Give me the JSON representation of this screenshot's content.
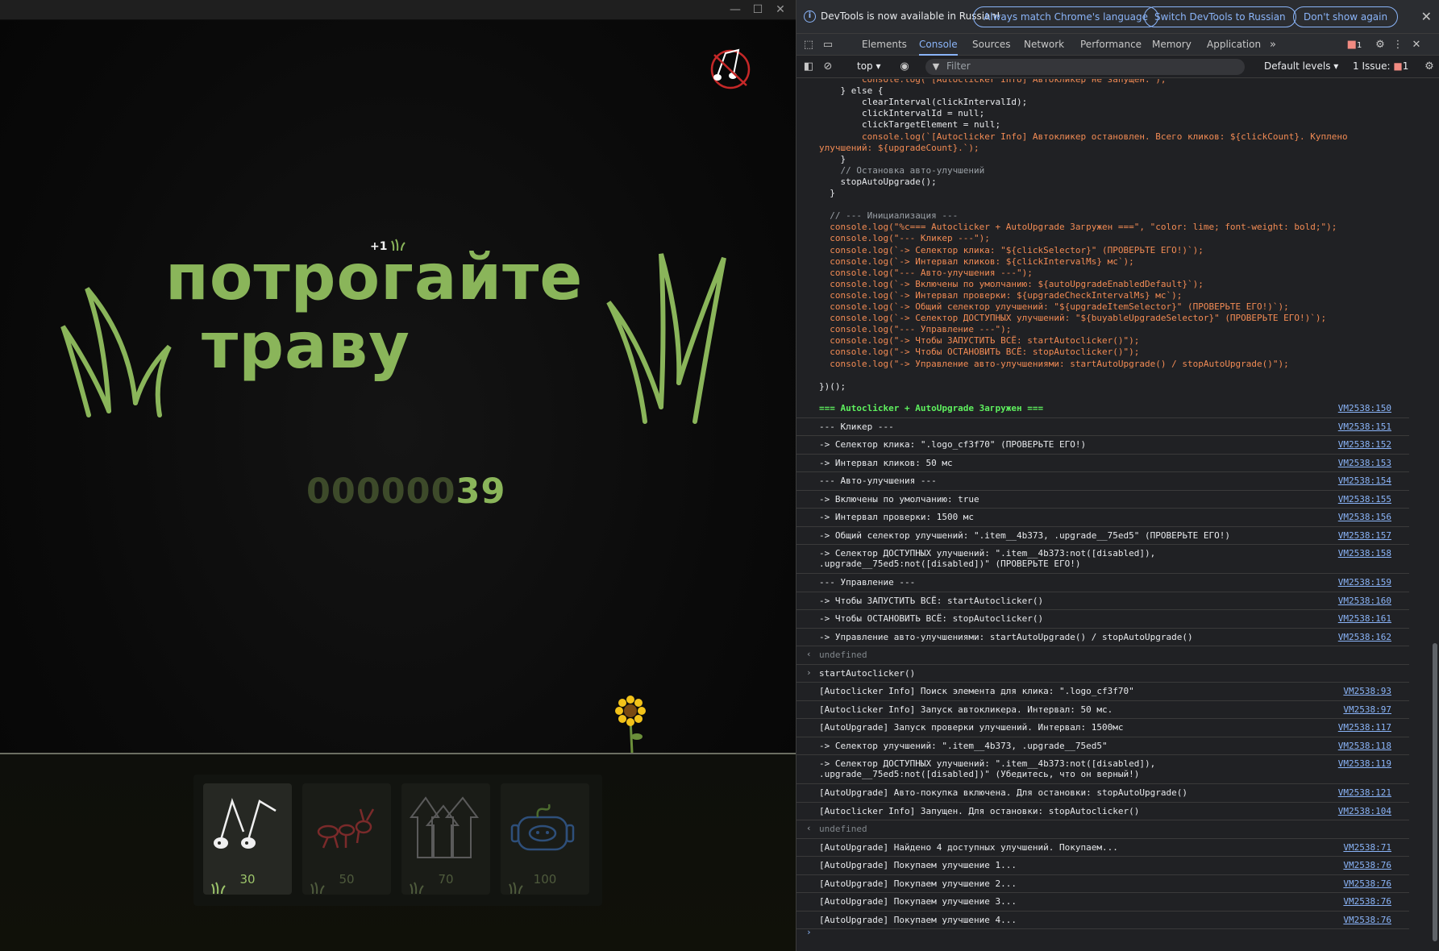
{
  "game": {
    "title_line1": "потрогайте",
    "title_line2": "траву",
    "plus_one": "+1",
    "counter_zeros": "000000",
    "counter_value": "39",
    "shop": [
      {
        "name": "music-upgrade",
        "price": "30",
        "available": true
      },
      {
        "name": "ant-upgrade",
        "price": "50",
        "available": false
      },
      {
        "name": "arrows-upgrade",
        "price": "70",
        "available": false
      },
      {
        "name": "robot-upgrade",
        "price": "100",
        "available": false
      }
    ]
  },
  "window": {
    "minimize": "—",
    "maximize": "☐",
    "close": "✕"
  },
  "devtools": {
    "infobar": {
      "message": "DevTools is now available in Russian!",
      "btn_match": "Always match Chrome's language",
      "btn_switch": "Switch DevTools to Russian",
      "btn_dont": "Don't show again"
    },
    "tabs": [
      "Elements",
      "Console",
      "Sources",
      "Network",
      "Performance",
      "Memory",
      "Application"
    ],
    "active_tab": "Console",
    "issues_badge": "1",
    "context": "top",
    "filter_placeholder": "Filter",
    "levels": "Default levels",
    "issues_label": "1 Issue:",
    "issues_count": "1",
    "code": [
      "        console.log(\"[Autoclicker Info] Автокликер не запущен.\");",
      "    } else {",
      "        clearInterval(clickIntervalId);",
      "        clickIntervalId = null;",
      "        clickTargetElement = null;",
      "        console.log(`[Autoclicker Info] Автокликер остановлен. Всего кликов: ${clickCount}. Куплено",
      "улучшений: ${upgradeCount}.`);",
      "    }",
      "    // Остановка авто-улучшений",
      "    stopAutoUpgrade();",
      "  }",
      "",
      "  // --- Инициализация ---",
      "  console.log(\"%c=== Autoclicker + AutoUpgrade Загружен ===\", \"color: lime; font-weight: bold;\");",
      "  console.log(\"--- Кликер ---\");",
      "  console.log(`-> Селектор клика: \"${clickSelector}\" (ПРОВЕРЬТЕ ЕГО!)`);",
      "  console.log(`-> Интервал кликов: ${clickIntervalMs} мс`);",
      "  console.log(\"--- Авто-улучшения ---\");",
      "  console.log(`-> Включены по умолчанию: ${autoUpgradeEnabledDefault}`);",
      "  console.log(`-> Интервал проверки: ${upgradeCheckIntervalMs} мс`);",
      "  console.log(`-> Общий селектор улучшений: \"${upgradeItemSelector}\" (ПРОВЕРЬТЕ ЕГО!)`);",
      "  console.log(`-> Селектор ДОСТУПНЫХ улучшений: \"${buyableUpgradeSelector}\" (ПРОВЕРЬТЕ ЕГО!)`);",
      "  console.log(\"--- Управление ---\");",
      "  console.log(\"-> Чтобы ЗАПУСТИТЬ ВСЁ: startAutoclicker()\");",
      "  console.log(\"-> Чтобы ОСТАНОВИТЬ ВСЁ: stopAutoclicker()\");",
      "  console.log(\"-> Управление авто-улучшениями: startAutoUpgrade() / stopAutoUpgrade()\");",
      "",
      "})();"
    ],
    "logs": [
      {
        "text": "=== Autoclicker + AutoUpgrade Загружен ===",
        "src": "VM2538:150",
        "style": "green"
      },
      {
        "text": "--- Кликер ---",
        "src": "VM2538:151"
      },
      {
        "text": "-> Селектор клика: \".logo_cf3f70\" (ПРОВЕРЬТЕ ЕГО!)",
        "src": "VM2538:152"
      },
      {
        "text": "-> Интервал кликов: 50 мс",
        "src": "VM2538:153"
      },
      {
        "text": "--- Авто-улучшения ---",
        "src": "VM2538:154"
      },
      {
        "text": "-> Включены по умолчанию: true",
        "src": "VM2538:155"
      },
      {
        "text": "-> Интервал проверки: 1500 мс",
        "src": "VM2538:156"
      },
      {
        "text": "-> Общий селектор улучшений: \".item__4b373, .upgrade__75ed5\" (ПРОВЕРЬТЕ ЕГО!)",
        "src": "VM2538:157"
      },
      {
        "text": "-> Селектор ДОСТУПНЫХ улучшений: \".item__4b373:not([disabled]),\n.upgrade__75ed5:not([disabled])\" (ПРОВЕРЬТЕ ЕГО!)",
        "src": "VM2538:158",
        "tall": true
      },
      {
        "text": "--- Управление ---",
        "src": "VM2538:159"
      },
      {
        "text": "-> Чтобы ЗАПУСТИТЬ ВСЁ: startAutoclicker()",
        "src": "VM2538:160"
      },
      {
        "text": "-> Чтобы ОСТАНОВИТЬ ВСЁ: stopAutoclicker()",
        "src": "VM2538:161"
      },
      {
        "text": "-> Управление авто-улучшениями: startAutoUpgrade() / stopAutoUpgrade()",
        "src": "VM2538:162"
      },
      {
        "text": "undefined",
        "src": "",
        "style": "muted",
        "glyph": "‹"
      },
      {
        "text": "startAutoclicker()",
        "src": "",
        "glyph": "›"
      },
      {
        "text": "[Autoclicker Info] Поиск элемента для клика: \".logo_cf3f70\"",
        "src": "VM2538:93"
      },
      {
        "text": "[Autoclicker Info] Запуск автокликера. Интервал: 50 мс.",
        "src": "VM2538:97"
      },
      {
        "text": "[AutoUpgrade] Запуск проверки улучшений. Интервал: 1500мс",
        "src": "VM2538:117"
      },
      {
        "text": "-> Селектор улучшений: \".item__4b373, .upgrade__75ed5\"",
        "src": "VM2538:118"
      },
      {
        "text": "-> Селектор ДОСТУПНЫХ улучшений: \".item__4b373:not([disabled]),\n.upgrade__75ed5:not([disabled])\" (Убедитесь, что он верный!)",
        "src": "VM2538:119",
        "tall": true
      },
      {
        "text": "[AutoUpgrade] Авто-покупка включена. Для остановки: stopAutoUpgrade()",
        "src": "VM2538:121"
      },
      {
        "text": "[Autoclicker Info] Запущен. Для остановки: stopAutoclicker()",
        "src": "VM2538:104"
      },
      {
        "text": "undefined",
        "src": "",
        "style": "muted",
        "glyph": "‹"
      },
      {
        "text": "[AutoUpgrade] Найдено 4 доступных улучшений. Покупаем...",
        "src": "VM2538:71"
      },
      {
        "text": "[AutoUpgrade] Покупаем улучшение 1...",
        "src": "VM2538:76"
      },
      {
        "text": "[AutoUpgrade] Покупаем улучшение 2...",
        "src": "VM2538:76"
      },
      {
        "text": "[AutoUpgrade] Покупаем улучшение 3...",
        "src": "VM2538:76"
      },
      {
        "text": "[AutoUpgrade] Покупаем улучшение 4...",
        "src": "VM2538:76"
      }
    ],
    "prompt_glyph": "›"
  }
}
